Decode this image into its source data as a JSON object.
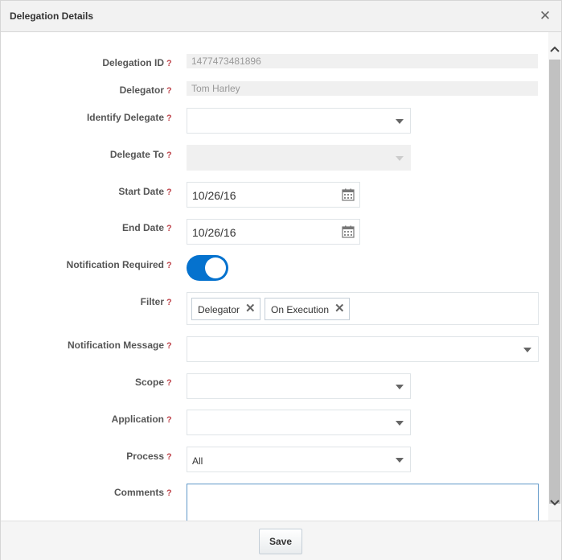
{
  "dialog": {
    "title": "Delegation Details",
    "close_icon": "close-icon"
  },
  "help_glyph": "?",
  "fields": {
    "delegation_id": {
      "label": "Delegation ID",
      "value": "1477473481896"
    },
    "delegator": {
      "label": "Delegator",
      "value": "Tom Harley"
    },
    "identify_delegate": {
      "label": "Identify Delegate",
      "value": ""
    },
    "delegate_to": {
      "label": "Delegate To",
      "value": ""
    },
    "start_date": {
      "label": "Start Date",
      "value": "10/26/16",
      "icon": "calendar-icon"
    },
    "end_date": {
      "label": "End Date",
      "value": "10/26/16",
      "icon": "calendar-icon"
    },
    "notification_required": {
      "label": "Notification Required",
      "on": true
    },
    "filter": {
      "label": "Filter",
      "chips": [
        "Delegator",
        "On Execution"
      ],
      "chip_remove_glyph": "✕"
    },
    "notification_message": {
      "label": "Notification Message",
      "value": ""
    },
    "scope": {
      "label": "Scope",
      "value": ""
    },
    "application": {
      "label": "Application",
      "value": ""
    },
    "process": {
      "label": "Process",
      "value": "All"
    },
    "comments": {
      "label": "Comments",
      "value": ""
    }
  },
  "footer": {
    "save_label": "Save"
  },
  "colors": {
    "accent": "#0572ce",
    "help": "#c0484f",
    "focus_border": "#5e97c8"
  }
}
